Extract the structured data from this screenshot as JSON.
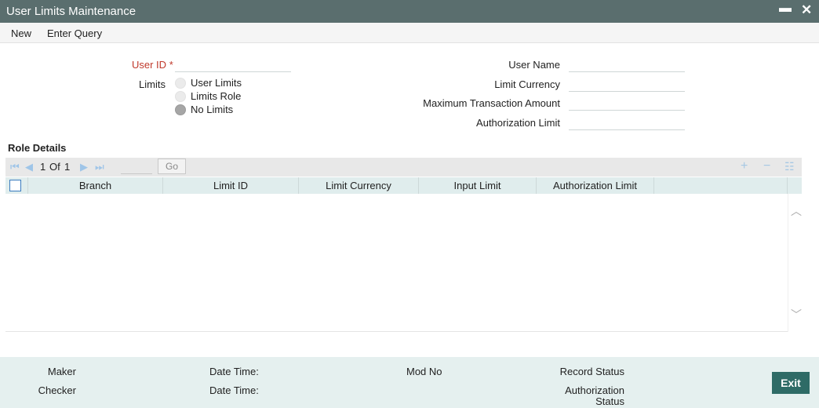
{
  "window": {
    "title": "User Limits Maintenance",
    "minimize_glyph": "▬",
    "close_glyph": "✕"
  },
  "menu": {
    "new": "New",
    "enter_query": "Enter Query"
  },
  "form": {
    "user_id_label": "User ID",
    "required_mark": "*",
    "limits_label": "Limits",
    "limits_options": [
      "User Limits",
      "Limits Role",
      "No Limits"
    ],
    "limits_selected": "No Limits",
    "user_name_label": "User Name",
    "limit_currency_label": "Limit Currency",
    "max_txn_amount_label": "Maximum Transaction Amount",
    "authorization_limit_label": "Authorization Limit",
    "user_id_value": "",
    "user_name_value": "",
    "limit_currency_value": "",
    "max_txn_amount_value": "",
    "authorization_limit_value": ""
  },
  "role_details": {
    "title": "Role Details",
    "pager": {
      "current": "1",
      "of_label": "Of",
      "total": "1",
      "go_label": "Go"
    },
    "columns": [
      "Branch",
      "Limit ID",
      "Limit Currency",
      "Input Limit",
      "Authorization Limit"
    ],
    "rows": []
  },
  "footer": {
    "maker_label": "Maker",
    "checker_label": "Checker",
    "date_time_label": "Date Time:",
    "mod_no_label": "Mod No",
    "record_status_label": "Record Status",
    "auth_status_line1": "Authorization",
    "auth_status_line2": "Status",
    "exit_label": "Exit"
  },
  "icons": {
    "first": "first-page-icon",
    "prev": "prev-page-icon",
    "next": "next-page-icon",
    "last": "last-page-icon",
    "add": "add-row-icon",
    "delete": "delete-row-icon",
    "view": "view-list-icon"
  },
  "colors": {
    "titlebar": "#5a6e6e",
    "required": "#c0392b",
    "exit_button": "#2e6b66",
    "footer": "#e5f0ef",
    "grid_header": "#e0eded"
  }
}
